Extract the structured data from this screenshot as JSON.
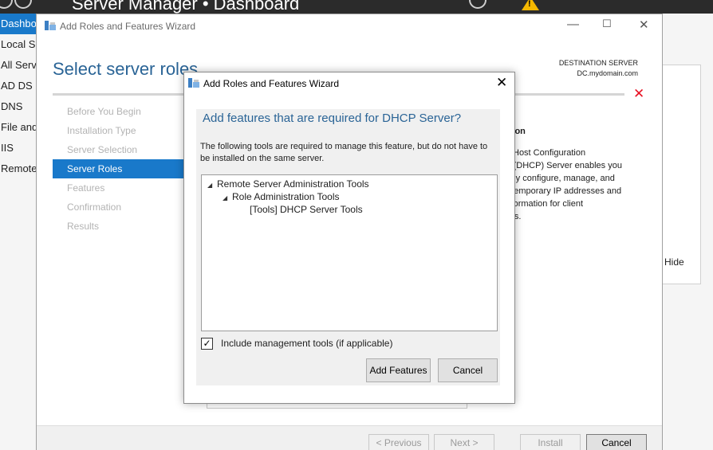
{
  "server_manager": {
    "title": "Server Manager • Dashboard",
    "nav_items": [
      "Dashbo",
      "Local Se",
      "All Serv",
      "AD DS",
      "DNS",
      "File and",
      "IIS",
      "Remote"
    ],
    "hide_label": "Hide"
  },
  "wizard": {
    "window_title": "Add Roles and Features Wizard",
    "heading": "Select server roles",
    "destination_label": "DESTINATION SERVER",
    "destination_server": "DC.mydomain.com",
    "steps": [
      {
        "label": "Before You Begin",
        "active": false
      },
      {
        "label": "Installation Type",
        "active": false
      },
      {
        "label": "Server Selection",
        "active": false
      },
      {
        "label": "Server Roles",
        "active": true
      },
      {
        "label": "Features",
        "active": false
      },
      {
        "label": "Confirmation",
        "active": false
      },
      {
        "label": "Results",
        "active": false
      }
    ],
    "description_title": "ption",
    "description_lines": [
      "ic Host Configuration",
      "ol (DHCP) Server enables you",
      "rally configure, manage, and",
      "e temporary IP addresses and",
      "information for client",
      "ters."
    ],
    "footer": {
      "previous": "< Previous",
      "next": "Next >",
      "install": "Install",
      "cancel": "Cancel"
    }
  },
  "dialog": {
    "title": "Add Roles and Features Wizard",
    "heading": "Add features that are required for DHCP Server?",
    "text": "The following tools are required to manage this feature, but do not have to be installed on the same server.",
    "tree": [
      {
        "label": "Remote Server Administration Tools",
        "expanded": true
      },
      {
        "label": "Role Administration Tools",
        "expanded": true
      },
      {
        "label": "[Tools] DHCP Server Tools",
        "expanded": false
      }
    ],
    "checkbox_label": "Include management tools (if applicable)",
    "checkbox_checked": true,
    "add_button": "Add Features",
    "cancel_button": "Cancel"
  },
  "colors": {
    "accent": "#1979ca",
    "heading": "#2a6496",
    "error": "#e81123",
    "warning": "#f5b800"
  }
}
